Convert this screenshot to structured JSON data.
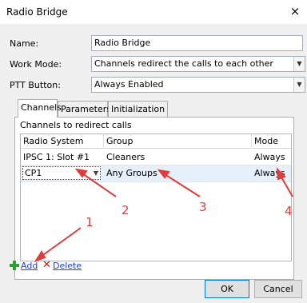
{
  "window": {
    "title": "Radio Bridge",
    "close_glyph": "×"
  },
  "form": {
    "name_label": "Name:",
    "name_value": "Radio Bridge",
    "work_mode_label": "Work Mode:",
    "work_mode_value": "Channels redirect the calls to each other",
    "ptt_label": "PTT Button:",
    "ptt_value": "Always Enabled"
  },
  "tabs": [
    {
      "label": "Channels",
      "active": true
    },
    {
      "label": "Parameters",
      "active": false
    },
    {
      "label": "Initialization",
      "active": false
    }
  ],
  "channels": {
    "group_label": "Channels to redirect calls",
    "columns": [
      "Radio System",
      "Group",
      "Mode"
    ],
    "rows": [
      {
        "radio_system": "IPSC 1: Slot #1",
        "group": "Cleaners",
        "mode": "Always"
      },
      {
        "radio_system": "CP1",
        "group": "Any Groups",
        "mode": "Always"
      }
    ]
  },
  "actions": {
    "add_label": "Add",
    "delete_label": "Delete",
    "add_icon": "green-plus-icon",
    "delete_icon": "red-x-icon"
  },
  "buttons": {
    "ok": "OK",
    "cancel": "Cancel"
  },
  "annotations": {
    "color": "#e03c3c",
    "labels": [
      "1",
      "2",
      "3",
      "4"
    ]
  }
}
